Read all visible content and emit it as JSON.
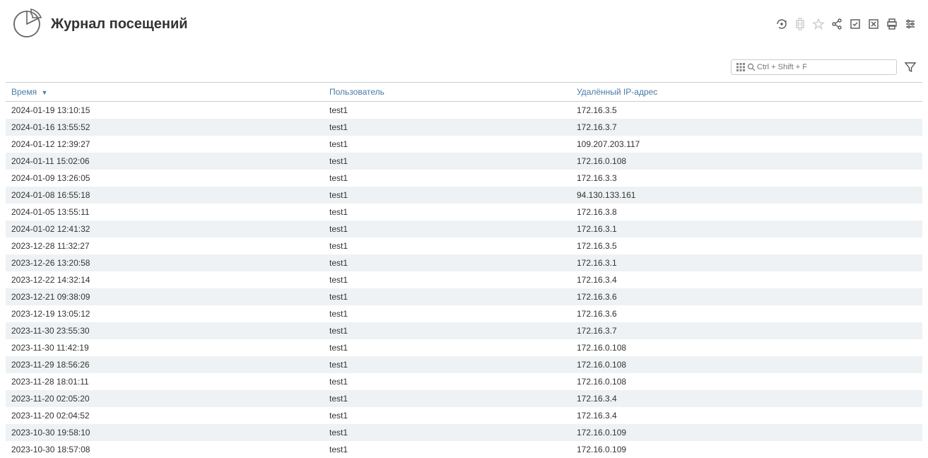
{
  "header": {
    "title": "Журнал посещений"
  },
  "search": {
    "placeholder": "Ctrl + Shift + F"
  },
  "table": {
    "columns": {
      "time": "Время",
      "user": "Пользователь",
      "ip": "Удалённый IP-адрес"
    },
    "rows": [
      {
        "time": "2024-01-19 13:10:15",
        "user": "test1",
        "ip": "172.16.3.5"
      },
      {
        "time": "2024-01-16 13:55:52",
        "user": "test1",
        "ip": "172.16.3.7"
      },
      {
        "time": "2024-01-12 12:39:27",
        "user": "test1",
        "ip": "109.207.203.117"
      },
      {
        "time": "2024-01-11 15:02:06",
        "user": "test1",
        "ip": "172.16.0.108"
      },
      {
        "time": "2024-01-09 13:26:05",
        "user": "test1",
        "ip": "172.16.3.3"
      },
      {
        "time": "2024-01-08 16:55:18",
        "user": "test1",
        "ip": "94.130.133.161"
      },
      {
        "time": "2024-01-05 13:55:11",
        "user": "test1",
        "ip": "172.16.3.8"
      },
      {
        "time": "2024-01-02 12:41:32",
        "user": "test1",
        "ip": "172.16.3.1"
      },
      {
        "time": "2023-12-28 11:32:27",
        "user": "test1",
        "ip": "172.16.3.5"
      },
      {
        "time": "2023-12-26 13:20:58",
        "user": "test1",
        "ip": "172.16.3.1"
      },
      {
        "time": "2023-12-22 14:32:14",
        "user": "test1",
        "ip": "172.16.3.4"
      },
      {
        "time": "2023-12-21 09:38:09",
        "user": "test1",
        "ip": "172.16.3.6"
      },
      {
        "time": "2023-12-19 13:05:12",
        "user": "test1",
        "ip": "172.16.3.6"
      },
      {
        "time": "2023-11-30 23:55:30",
        "user": "test1",
        "ip": "172.16.3.7"
      },
      {
        "time": "2023-11-30 11:42:19",
        "user": "test1",
        "ip": "172.16.0.108"
      },
      {
        "time": "2023-11-29 18:56:26",
        "user": "test1",
        "ip": "172.16.0.108"
      },
      {
        "time": "2023-11-28 18:01:11",
        "user": "test1",
        "ip": "172.16.0.108"
      },
      {
        "time": "2023-11-20 02:05:20",
        "user": "test1",
        "ip": "172.16.3.4"
      },
      {
        "time": "2023-11-20 02:04:52",
        "user": "test1",
        "ip": "172.16.3.4"
      },
      {
        "time": "2023-10-30 19:58:10",
        "user": "test1",
        "ip": "172.16.0.109"
      },
      {
        "time": "2023-10-30 18:57:08",
        "user": "test1",
        "ip": "172.16.0.109"
      }
    ]
  }
}
